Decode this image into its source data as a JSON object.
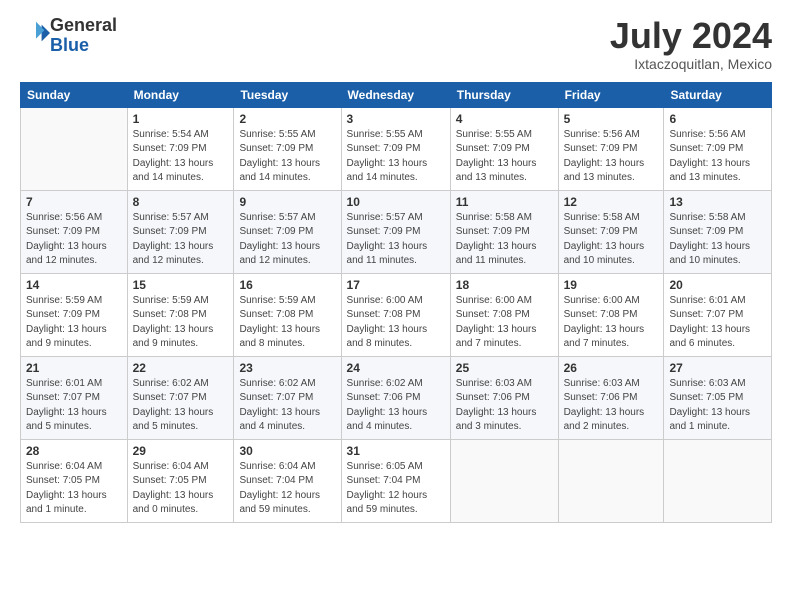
{
  "logo": {
    "general": "General",
    "blue": "Blue"
  },
  "title": "July 2024",
  "subtitle": "Ixtaczoquitlan, Mexico",
  "weekdays": [
    "Sunday",
    "Monday",
    "Tuesday",
    "Wednesday",
    "Thursday",
    "Friday",
    "Saturday"
  ],
  "weeks": [
    [
      {
        "day": null,
        "info": null
      },
      {
        "day": "1",
        "info": "Sunrise: 5:54 AM\nSunset: 7:09 PM\nDaylight: 13 hours\nand 14 minutes."
      },
      {
        "day": "2",
        "info": "Sunrise: 5:55 AM\nSunset: 7:09 PM\nDaylight: 13 hours\nand 14 minutes."
      },
      {
        "day": "3",
        "info": "Sunrise: 5:55 AM\nSunset: 7:09 PM\nDaylight: 13 hours\nand 14 minutes."
      },
      {
        "day": "4",
        "info": "Sunrise: 5:55 AM\nSunset: 7:09 PM\nDaylight: 13 hours\nand 13 minutes."
      },
      {
        "day": "5",
        "info": "Sunrise: 5:56 AM\nSunset: 7:09 PM\nDaylight: 13 hours\nand 13 minutes."
      },
      {
        "day": "6",
        "info": "Sunrise: 5:56 AM\nSunset: 7:09 PM\nDaylight: 13 hours\nand 13 minutes."
      }
    ],
    [
      {
        "day": "7",
        "info": "Sunrise: 5:56 AM\nSunset: 7:09 PM\nDaylight: 13 hours\nand 12 minutes."
      },
      {
        "day": "8",
        "info": "Sunrise: 5:57 AM\nSunset: 7:09 PM\nDaylight: 13 hours\nand 12 minutes."
      },
      {
        "day": "9",
        "info": "Sunrise: 5:57 AM\nSunset: 7:09 PM\nDaylight: 13 hours\nand 12 minutes."
      },
      {
        "day": "10",
        "info": "Sunrise: 5:57 AM\nSunset: 7:09 PM\nDaylight: 13 hours\nand 11 minutes."
      },
      {
        "day": "11",
        "info": "Sunrise: 5:58 AM\nSunset: 7:09 PM\nDaylight: 13 hours\nand 11 minutes."
      },
      {
        "day": "12",
        "info": "Sunrise: 5:58 AM\nSunset: 7:09 PM\nDaylight: 13 hours\nand 10 minutes."
      },
      {
        "day": "13",
        "info": "Sunrise: 5:58 AM\nSunset: 7:09 PM\nDaylight: 13 hours\nand 10 minutes."
      }
    ],
    [
      {
        "day": "14",
        "info": "Sunrise: 5:59 AM\nSunset: 7:09 PM\nDaylight: 13 hours\nand 9 minutes."
      },
      {
        "day": "15",
        "info": "Sunrise: 5:59 AM\nSunset: 7:08 PM\nDaylight: 13 hours\nand 9 minutes."
      },
      {
        "day": "16",
        "info": "Sunrise: 5:59 AM\nSunset: 7:08 PM\nDaylight: 13 hours\nand 8 minutes."
      },
      {
        "day": "17",
        "info": "Sunrise: 6:00 AM\nSunset: 7:08 PM\nDaylight: 13 hours\nand 8 minutes."
      },
      {
        "day": "18",
        "info": "Sunrise: 6:00 AM\nSunset: 7:08 PM\nDaylight: 13 hours\nand 7 minutes."
      },
      {
        "day": "19",
        "info": "Sunrise: 6:00 AM\nSunset: 7:08 PM\nDaylight: 13 hours\nand 7 minutes."
      },
      {
        "day": "20",
        "info": "Sunrise: 6:01 AM\nSunset: 7:07 PM\nDaylight: 13 hours\nand 6 minutes."
      }
    ],
    [
      {
        "day": "21",
        "info": "Sunrise: 6:01 AM\nSunset: 7:07 PM\nDaylight: 13 hours\nand 5 minutes."
      },
      {
        "day": "22",
        "info": "Sunrise: 6:02 AM\nSunset: 7:07 PM\nDaylight: 13 hours\nand 5 minutes."
      },
      {
        "day": "23",
        "info": "Sunrise: 6:02 AM\nSunset: 7:07 PM\nDaylight: 13 hours\nand 4 minutes."
      },
      {
        "day": "24",
        "info": "Sunrise: 6:02 AM\nSunset: 7:06 PM\nDaylight: 13 hours\nand 4 minutes."
      },
      {
        "day": "25",
        "info": "Sunrise: 6:03 AM\nSunset: 7:06 PM\nDaylight: 13 hours\nand 3 minutes."
      },
      {
        "day": "26",
        "info": "Sunrise: 6:03 AM\nSunset: 7:06 PM\nDaylight: 13 hours\nand 2 minutes."
      },
      {
        "day": "27",
        "info": "Sunrise: 6:03 AM\nSunset: 7:05 PM\nDaylight: 13 hours\nand 1 minute."
      }
    ],
    [
      {
        "day": "28",
        "info": "Sunrise: 6:04 AM\nSunset: 7:05 PM\nDaylight: 13 hours\nand 1 minute."
      },
      {
        "day": "29",
        "info": "Sunrise: 6:04 AM\nSunset: 7:05 PM\nDaylight: 13 hours\nand 0 minutes."
      },
      {
        "day": "30",
        "info": "Sunrise: 6:04 AM\nSunset: 7:04 PM\nDaylight: 12 hours\nand 59 minutes."
      },
      {
        "day": "31",
        "info": "Sunrise: 6:05 AM\nSunset: 7:04 PM\nDaylight: 12 hours\nand 59 minutes."
      },
      {
        "day": null,
        "info": null
      },
      {
        "day": null,
        "info": null
      },
      {
        "day": null,
        "info": null
      }
    ]
  ]
}
